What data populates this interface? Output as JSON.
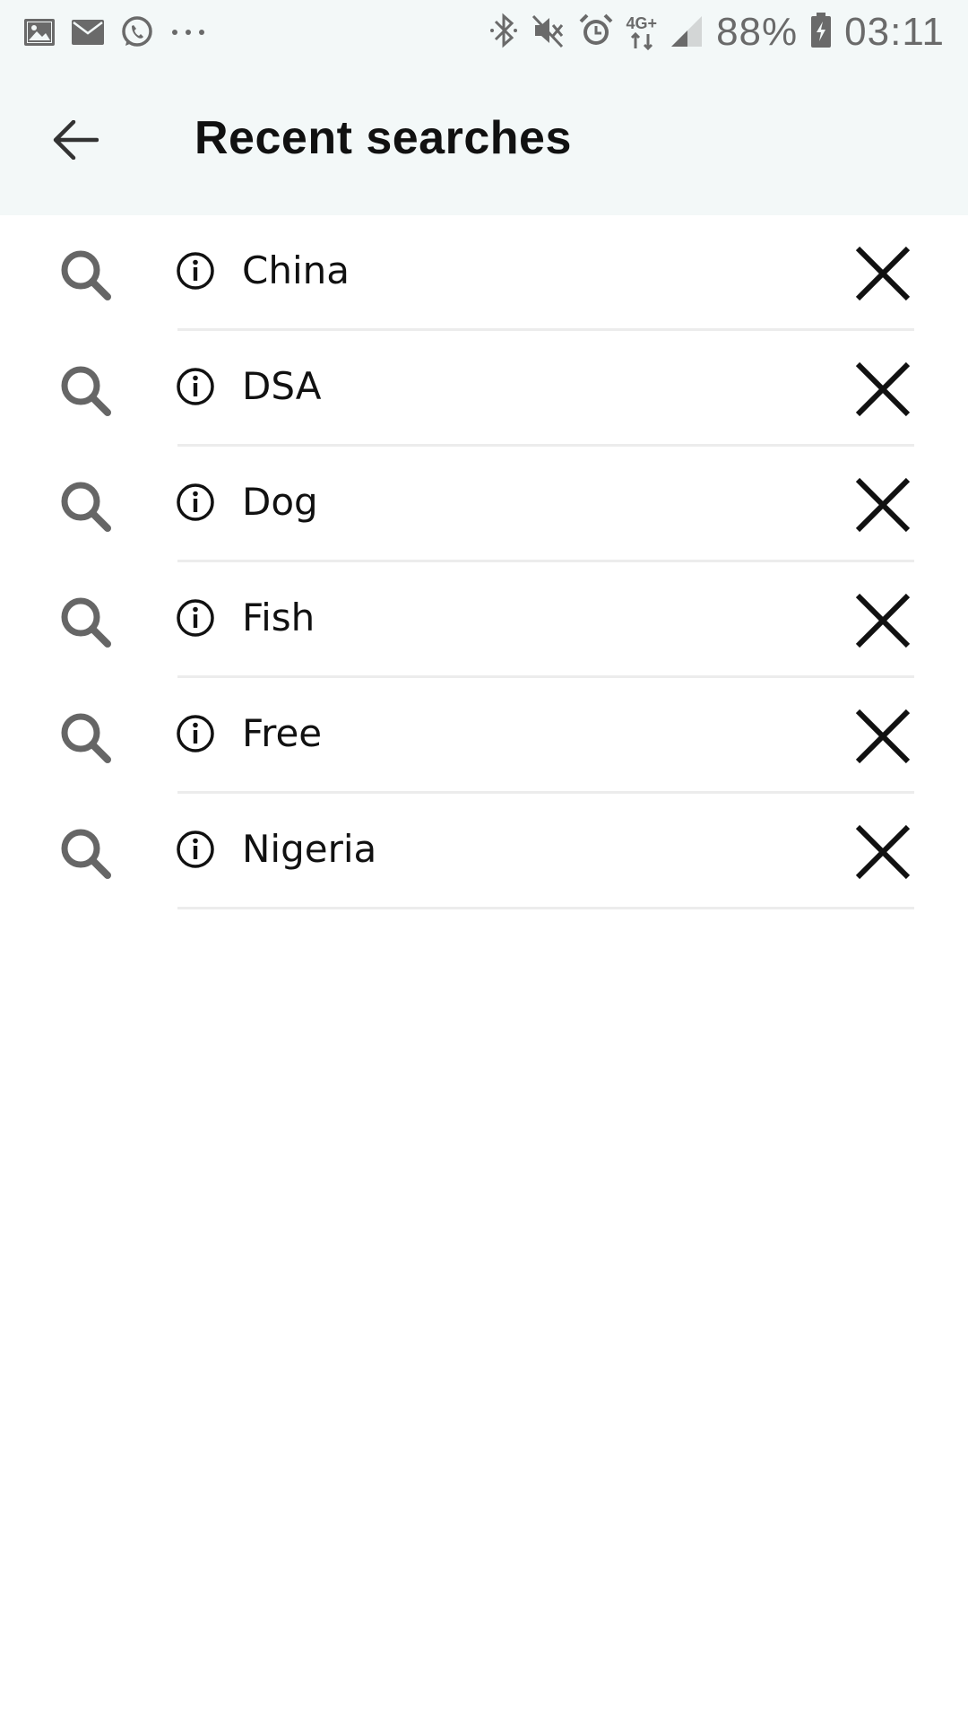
{
  "status_bar": {
    "notification_icons": [
      "gallery-icon",
      "email-icon",
      "whatsapp-icon",
      "more-dots-icon"
    ],
    "system_icons": [
      "bluetooth-icon",
      "mute-icon",
      "alarm-icon",
      "network-4g-icon",
      "signal-icon",
      "battery-icon"
    ],
    "network_label": "4G+",
    "battery": "88%",
    "time": "03:11"
  },
  "header": {
    "back_icon": "arrow-left-icon",
    "title": "Recent searches",
    "background": "#f3f8f8"
  },
  "recent_searches": [
    {
      "label": "China"
    },
    {
      "label": "DSA"
    },
    {
      "label": "Dog"
    },
    {
      "label": "Fish"
    },
    {
      "label": "Free"
    },
    {
      "label": "Nigeria"
    }
  ],
  "row_icons": {
    "leading": "search-icon",
    "info": "info-icon",
    "trailing": "close-icon"
  }
}
